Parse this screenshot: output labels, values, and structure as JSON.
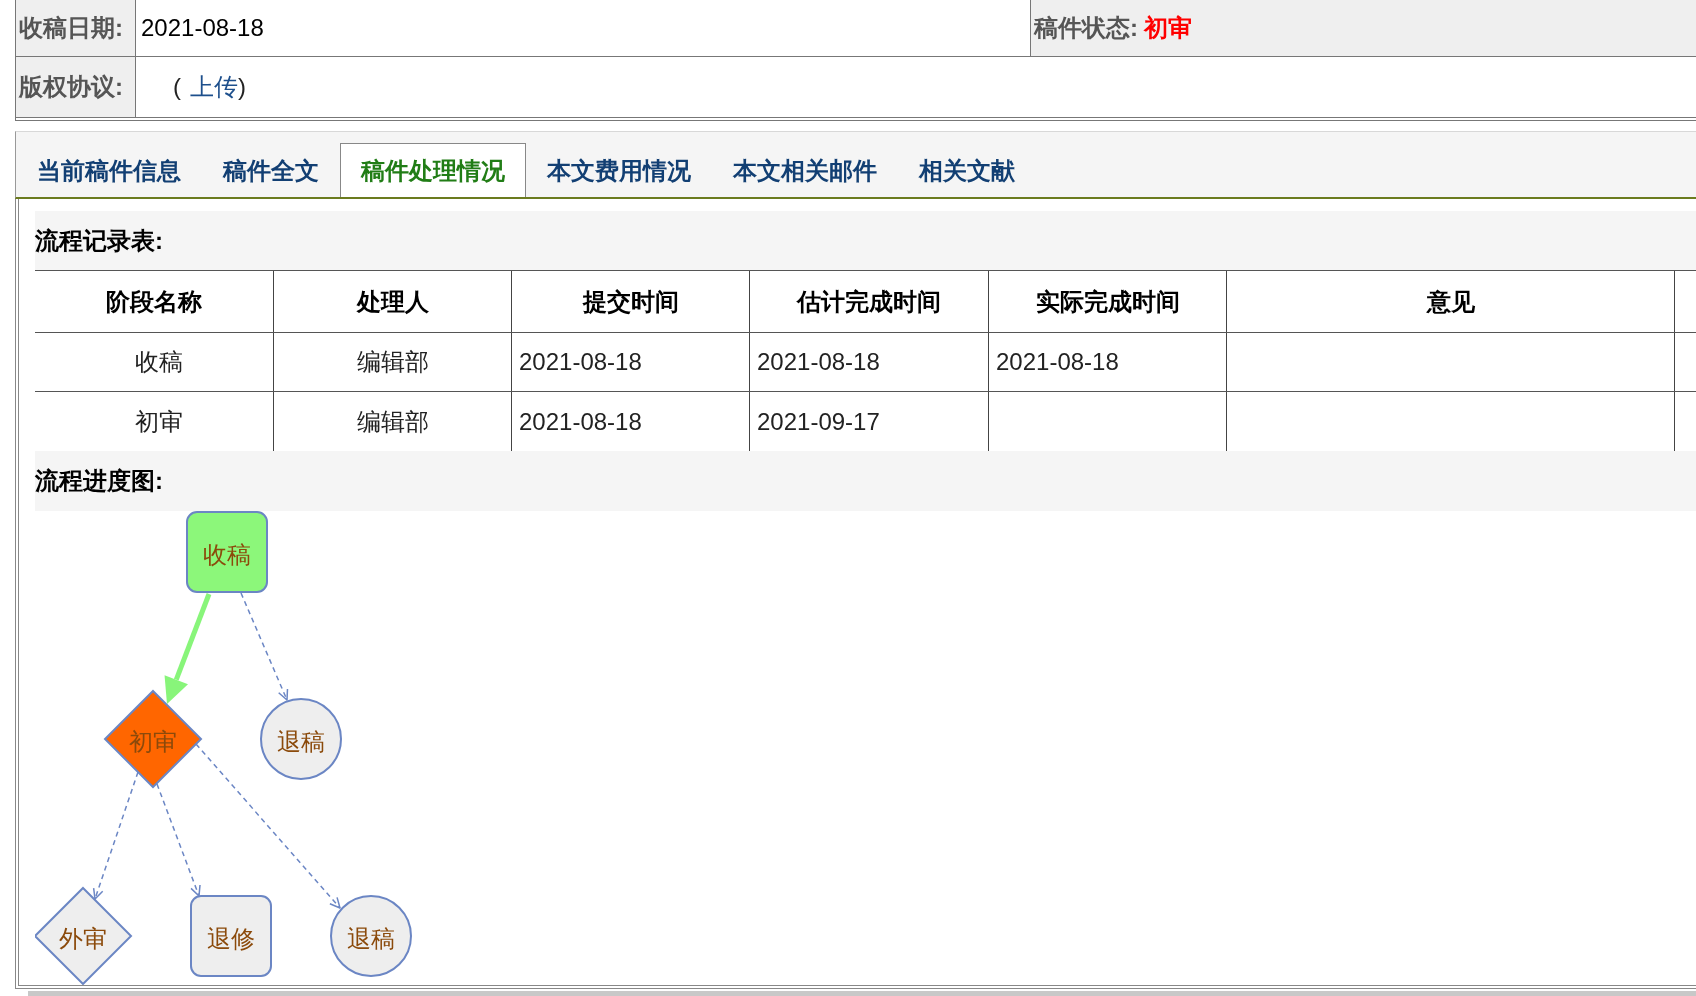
{
  "record": {
    "received_date": {
      "label": "收稿日期:",
      "value": "2021-08-18"
    },
    "status": {
      "label": "稿件状态:",
      "value": "初审"
    },
    "copyright": {
      "label": "版权协议:",
      "open": "(",
      "link": "上传",
      "close": ")"
    }
  },
  "tabs": [
    {
      "label": "当前稿件信息",
      "selected": false
    },
    {
      "label": "稿件全文",
      "selected": false
    },
    {
      "label": "稿件处理情况",
      "selected": true
    },
    {
      "label": "本文费用情况",
      "selected": false
    },
    {
      "label": "本文相关邮件",
      "selected": false
    },
    {
      "label": "相关文献",
      "selected": false
    }
  ],
  "flow_table": {
    "title": "流程记录表:",
    "columns": [
      "阶段名称",
      "处理人",
      "提交时间",
      "估计完成时间",
      "实际完成时间",
      "意见"
    ],
    "rows": [
      {
        "stage": "收稿",
        "handler": "编辑部",
        "submitted": "2021-08-18",
        "estimated": "2021-08-18",
        "actual": "2021-08-18"
      },
      {
        "stage": "初审",
        "handler": "编辑部",
        "submitted": "2021-08-18",
        "estimated": "2021-09-17"
      }
    ]
  },
  "flow_chart": {
    "title": "流程进度图:",
    "root": {
      "kind": "rounded",
      "label": "收稿",
      "done": true,
      "current": false,
      "children": [
        {
          "kind": "diamond",
          "label": "初审",
          "done": false,
          "current": true,
          "children": [
            {
              "kind": "diamond",
              "label": "外审",
              "done": false,
              "current": false
            },
            {
              "kind": "rounded",
              "label": "退修",
              "done": false,
              "current": false
            },
            {
              "kind": "circle",
              "label": "退稿",
              "done": false,
              "current": false
            }
          ]
        },
        {
          "kind": "circle",
          "label": "退稿",
          "done": false,
          "current": false
        }
      ]
    }
  }
}
